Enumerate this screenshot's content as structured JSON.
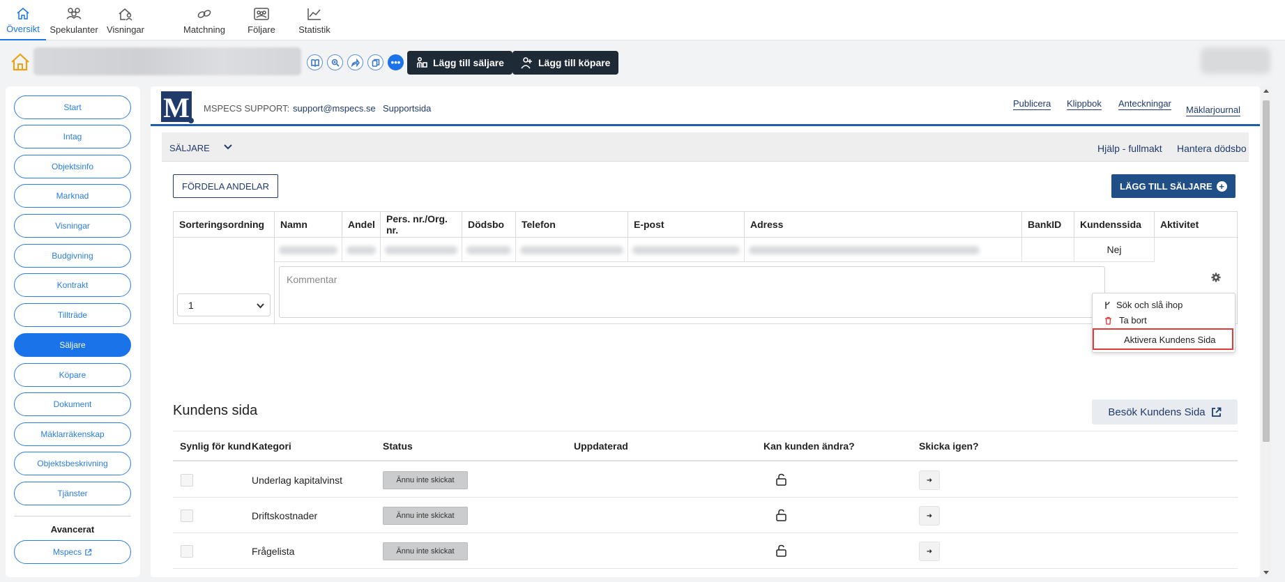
{
  "nav": {
    "tabs": [
      {
        "label": "Översikt",
        "icon": "home-icon",
        "active": true
      },
      {
        "label": "Spekulanter",
        "icon": "people-icon"
      },
      {
        "label": "Visningar",
        "icon": "house-person-icon"
      },
      {
        "label": "Matchning",
        "icon": "link-icon"
      },
      {
        "label": "Följare",
        "icon": "group-icon"
      },
      {
        "label": "Statistik",
        "icon": "chart-icon"
      }
    ]
  },
  "actions": {
    "add_seller": "Lägg till säljare",
    "add_buyer": "Lägg till köpare"
  },
  "sidebar": {
    "items": [
      "Start",
      "Intag",
      "Objektsinfo",
      "Marknad",
      "Visningar",
      "Budgivning",
      "Kontrakt",
      "Tillträde",
      "Säljare",
      "Köpare",
      "Dokument",
      "Mäklarräkenskap",
      "Objektsbeskrivning",
      "Tjänster"
    ],
    "active": "Säljare",
    "advanced_title": "Avancerat",
    "mspecs": "Mspecs"
  },
  "header": {
    "logo": "M",
    "support_label": "MSPECS SUPPORT:",
    "support_email": "support@mspecs.se",
    "support_page": "Supportsida",
    "links": [
      "Publicera",
      "Klippbok",
      "Anteckningar",
      "Mäklarjournal"
    ]
  },
  "seller_section": {
    "title": "SÄLJARE",
    "help_link": "Hjälp - fullmakt",
    "estate_link": "Hantera dödsbo",
    "distribute_button": "FÖRDELA ANDELAR",
    "add_button": "LÄGG TILL SÄLJARE",
    "columns": [
      "Sorteringsordning",
      "Namn",
      "Andel",
      "Pers. nr./Org. nr.",
      "Dödsbo",
      "Telefon",
      "E-post",
      "Adress",
      "BankID",
      "Kundenssida",
      "Aktivitet"
    ],
    "row": {
      "sort_order": "1",
      "kundenssida": "Nej",
      "comment_placeholder": "Kommentar"
    },
    "menu": {
      "search_merge": "Sök och slå ihop",
      "delete": "Ta bort",
      "activate": "Aktivera Kundens Sida"
    }
  },
  "customer_page": {
    "title": "Kundens sida",
    "visit_button": "Besök Kundens Sida",
    "columns": [
      "Synlig för kund",
      "Kategori",
      "Status",
      "Uppdaterad",
      "Kan kunden ändra?",
      "Skicka igen?"
    ],
    "rows": [
      {
        "category": "Underlag kapitalvinst",
        "status": "Ännu inte skickat"
      },
      {
        "category": "Driftskostnader",
        "status": "Ännu inte skickat"
      },
      {
        "category": "Frågelista",
        "status": "Ännu inte skickat"
      }
    ]
  },
  "colors": {
    "accent": "#1a73e8",
    "navy": "#1f3a6b",
    "dark_button": "#1f2a37",
    "highlight": "#e03a3a"
  }
}
